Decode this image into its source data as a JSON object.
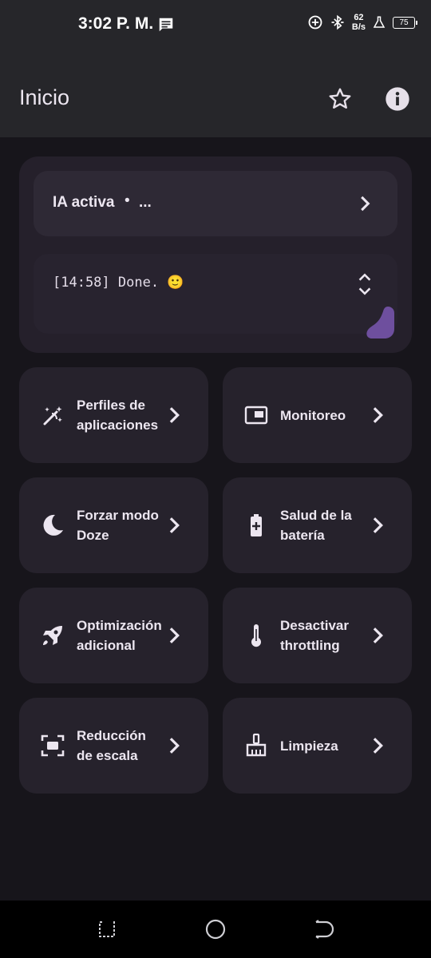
{
  "status_bar": {
    "time": "3:02 P. M.",
    "net_rate_value": "62",
    "net_rate_unit": "B/s",
    "battery": "75"
  },
  "app_bar": {
    "title": "Inicio",
    "icons": [
      "star-outline-icon",
      "info-icon"
    ]
  },
  "ai_card": {
    "status_label": "IA activa",
    "separator": "•",
    "status_value": "...",
    "log_text": "[14:58] Done. 🙂"
  },
  "tiles": [
    {
      "label": "Perfiles de aplicaciones",
      "icon": "magic-wand-icon"
    },
    {
      "label": "Monitoreo",
      "icon": "picture-in-picture-icon"
    },
    {
      "label": "Forzar modo Doze",
      "icon": "moon-icon"
    },
    {
      "label": "Salud de la batería",
      "icon": "battery-plus-icon"
    },
    {
      "label": "Optimización adicional",
      "icon": "rocket-icon"
    },
    {
      "label": "Desactivar throttling",
      "icon": "thermometer-icon"
    },
    {
      "label": "Reducción de escala",
      "icon": "fit-screen-icon"
    },
    {
      "label": "Limpieza",
      "icon": "broom-icon"
    }
  ],
  "colors": {
    "background": "#17151b",
    "appbar": "#26262a",
    "card": "#26222c",
    "accent": "#7a5aa8"
  }
}
